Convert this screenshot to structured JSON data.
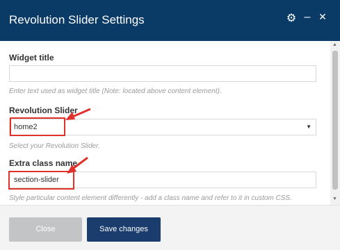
{
  "dialog": {
    "title": "Revolution Slider Settings",
    "icons": [
      "gear-icon",
      "minimize-icon",
      "close-icon"
    ],
    "icon_glyphs": {
      "gear": "⚙",
      "minimize": "–",
      "close": "✕"
    }
  },
  "fields": {
    "widget_title": {
      "label": "Widget title",
      "value": "",
      "hint": "Enter text used as widget title (Note: located above content element)."
    },
    "revolution_slider": {
      "label": "Revolution Slider",
      "value": "home2",
      "hint": "Select your Revolution Slider.",
      "caret": "▼"
    },
    "extra_class": {
      "label": "Extra class name",
      "value": "section-slider",
      "hint": "Style particular content element differently - add a class name and refer to it in custom CSS."
    }
  },
  "footer": {
    "close_label": "Close",
    "save_label": "Save changes"
  },
  "colors": {
    "header": "#0a3a66",
    "save_button": "#1a3d6e",
    "close_button": "#c2c4c6",
    "annotation": "#e0312b"
  }
}
